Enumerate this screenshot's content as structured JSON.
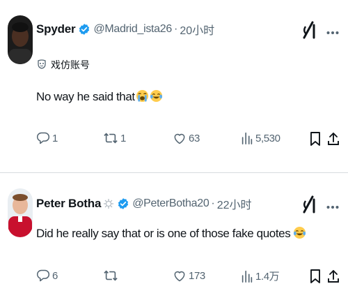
{
  "tweets": [
    {
      "name": "Spyder",
      "handle": "@Madrid_ista26",
      "separator": "·",
      "time": "20小时",
      "parody_label": "戏仿账号",
      "text": "No way he said that",
      "emojis": [
        "loudly-crying-face",
        "face-with-tears-of-joy"
      ],
      "stats": {
        "replies": "1",
        "reposts": "1",
        "likes": "63",
        "views": "5,530"
      }
    },
    {
      "name": "Peter Botha",
      "name_badge": "sunburst-emoji",
      "handle": "@PeterBotha20",
      "separator": "·",
      "time": "22小时",
      "text": "Did he really say that or is one of those fake quotes",
      "emojis": [
        "face-with-tears-of-joy"
      ],
      "stats": {
        "replies": "6",
        "reposts": "",
        "likes": "173",
        "views": "1.4万"
      }
    }
  ],
  "icons": {
    "grok": "grok-icon",
    "more": "more-icon",
    "reply": "reply-icon",
    "repost": "repost-icon",
    "like": "like-icon",
    "views": "views-icon",
    "bookmark": "bookmark-icon",
    "share": "share-icon",
    "verified": "verified-badge-icon"
  },
  "colors": {
    "verified_blue": "#1d9bf0",
    "text_primary": "#0f1419",
    "text_secondary": "#536471",
    "divider": "#d7dbdf"
  }
}
